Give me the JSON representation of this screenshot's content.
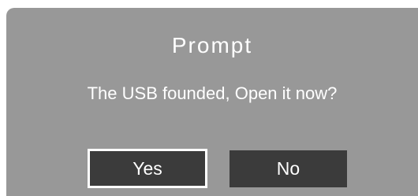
{
  "dialog": {
    "title": "Prompt",
    "message": "The USB founded, Open it now?",
    "buttons": {
      "yes_label": "Yes",
      "no_label": "No",
      "focused": "Yes"
    }
  },
  "colors": {
    "dialog_background": "#989898",
    "button_background": "#3b3b3b",
    "text": "#ffffff",
    "focus_border": "#ffffff"
  }
}
